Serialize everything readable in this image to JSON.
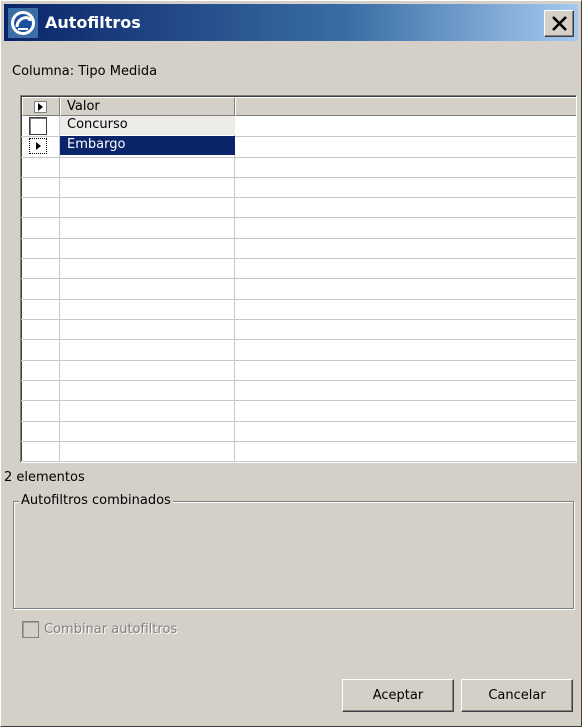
{
  "window": {
    "title": "Autofiltros",
    "close_glyph": "✕",
    "icon": "app-logo-icon"
  },
  "column": {
    "label": "Columna:  Tipo Medida"
  },
  "grid": {
    "headers": [
      "Valor"
    ],
    "rows": [
      {
        "value": "Concurso",
        "checked": false,
        "selected": false
      },
      {
        "value": "Embargo",
        "checked": false,
        "selected": true
      }
    ],
    "selection_color": "#0a246a"
  },
  "count_label": "2 elementos",
  "combined": {
    "title": "Autofiltros combinados",
    "checkbox_label": "Combinar autofiltros",
    "checkbox_enabled": false
  },
  "buttons": {
    "accept": "Aceptar",
    "cancel": "Cancelar"
  }
}
